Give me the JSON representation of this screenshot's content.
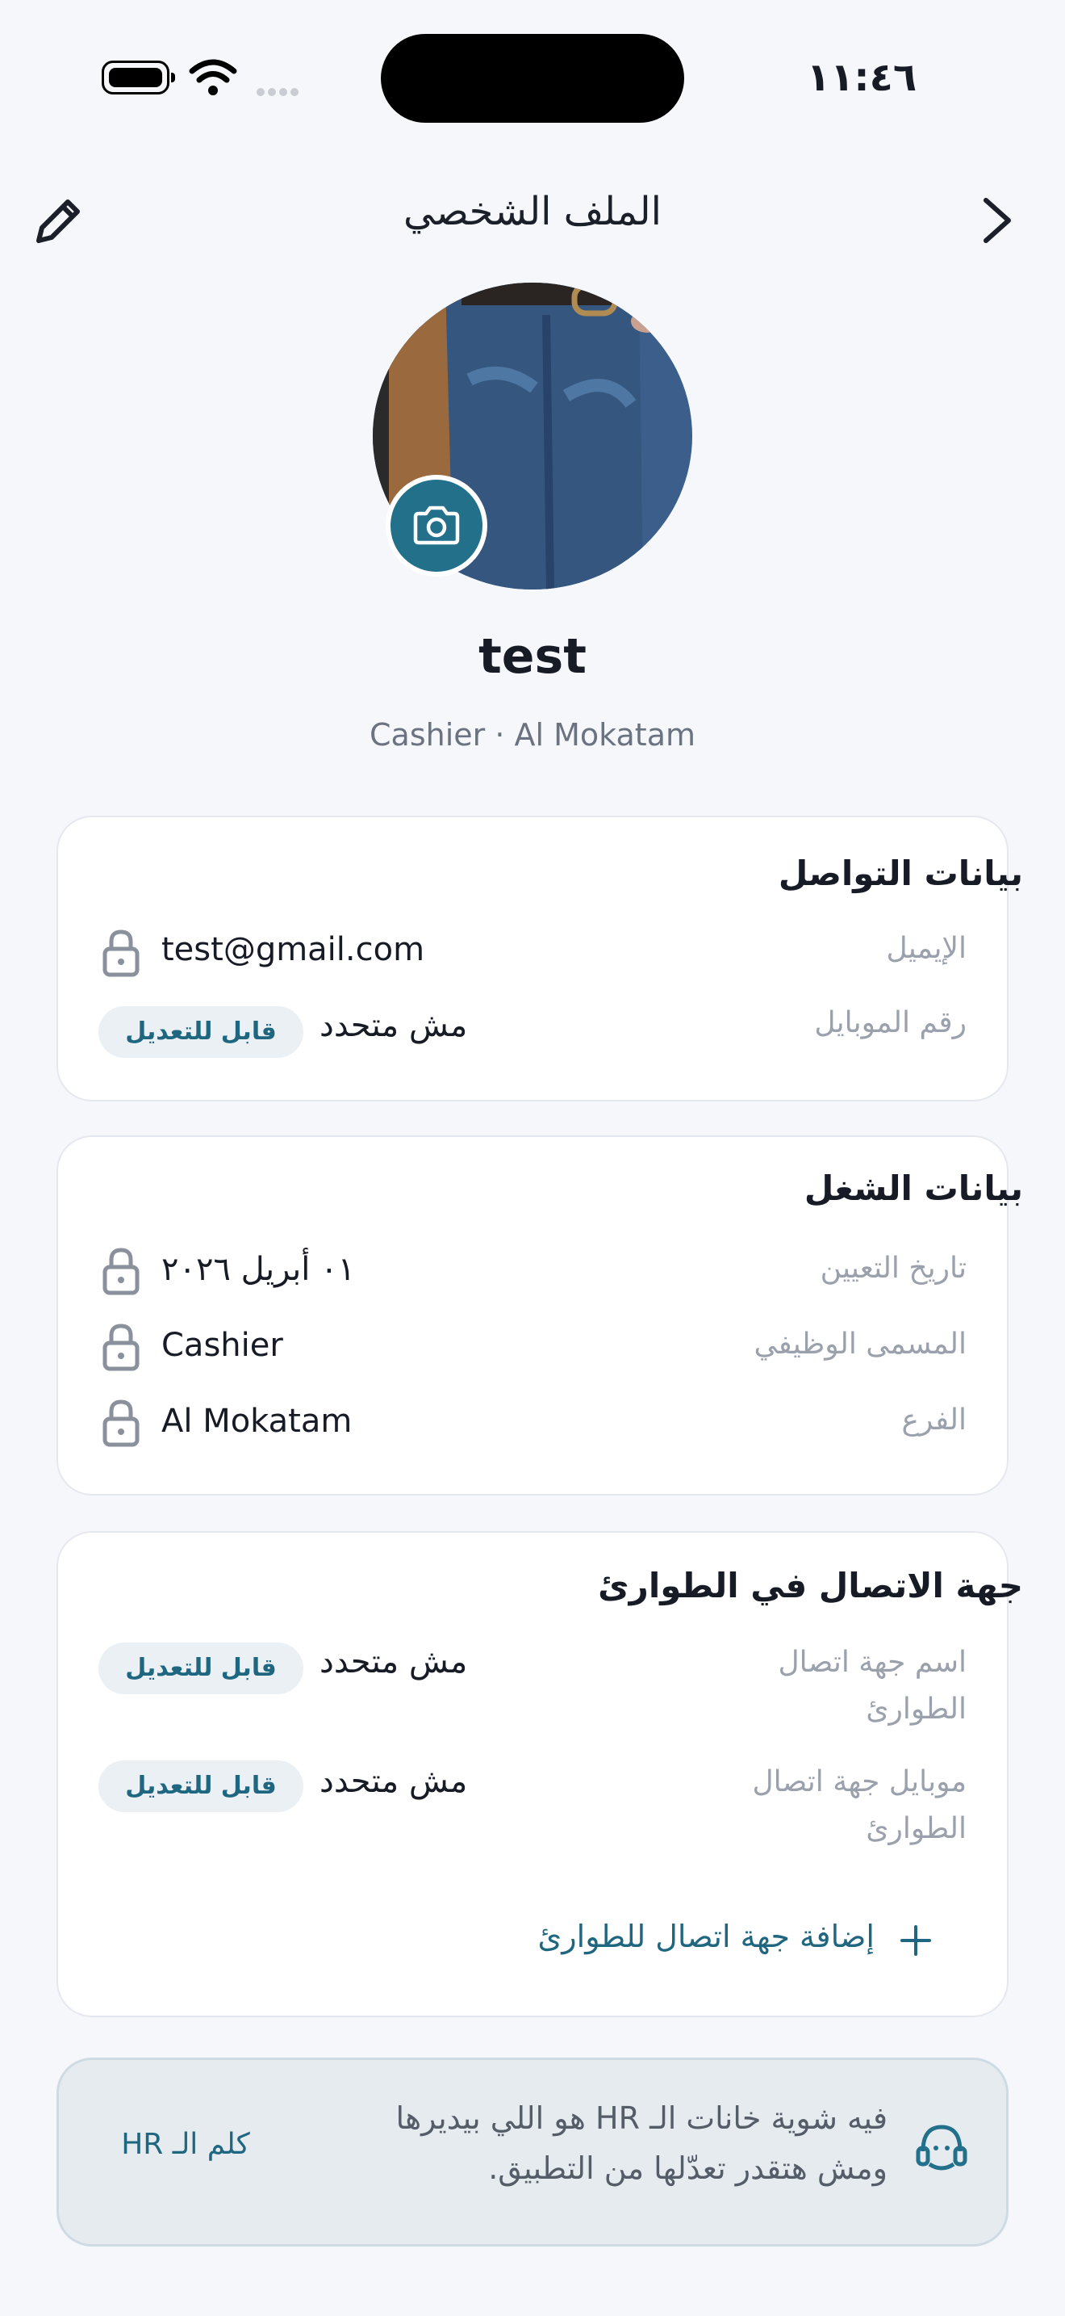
{
  "status_bar": {
    "time": "١١:٤٦",
    "battery_icon": "battery-icon",
    "wifi_icon": "wifi-icon"
  },
  "header": {
    "title": "الملف الشخصي",
    "edit_icon": "pencil-icon",
    "back_icon": "chevron-right-icon"
  },
  "profile": {
    "name": "test",
    "subtitle": "Cashier · Al Mokatam",
    "camera_icon": "camera-icon"
  },
  "contact_card": {
    "title": "بيانات التواصل",
    "rows": [
      {
        "label": "الإيميل",
        "value": "test@gmail.com",
        "locked": true
      },
      {
        "label": "رقم الموبايل",
        "value": "مش متحدد",
        "badge": "قابل للتعديل"
      }
    ]
  },
  "work_card": {
    "title": "بيانات الشغل",
    "rows": [
      {
        "label": "تاريخ التعيين",
        "value": "٠١ أبريل ٢٠٢٦",
        "locked": true
      },
      {
        "label": "المسمى الوظيفي",
        "value": "Cashier",
        "locked": true
      },
      {
        "label": "الفرع",
        "value": "Al Mokatam",
        "locked": true
      }
    ]
  },
  "emergency_card": {
    "title": "جهة الاتصال في الطوارئ",
    "rows": [
      {
        "label_line1": "اسم جهة اتصال",
        "label_line2": "الطوارئ",
        "value": "مش متحدد",
        "badge": "قابل للتعديل"
      },
      {
        "label_line1": "موبايل جهة اتصال",
        "label_line2": "الطوارئ",
        "value": "مش متحدد",
        "badge": "قابل للتعديل"
      }
    ],
    "add_label": "إضافة جهة اتصال للطوارئ"
  },
  "hr_note": {
    "line1": "فيه شوية خانات الـ HR هو اللي بيديرها",
    "line2": "ومش هتقدر تعدّلها من التطبيق.",
    "link": "كلم الـ HR",
    "icon": "support-agent-icon"
  },
  "colors": {
    "accent": "#23708b",
    "background": "#f5f7fa",
    "card": "#ffffff",
    "badge_bg": "#eaf0f3"
  }
}
